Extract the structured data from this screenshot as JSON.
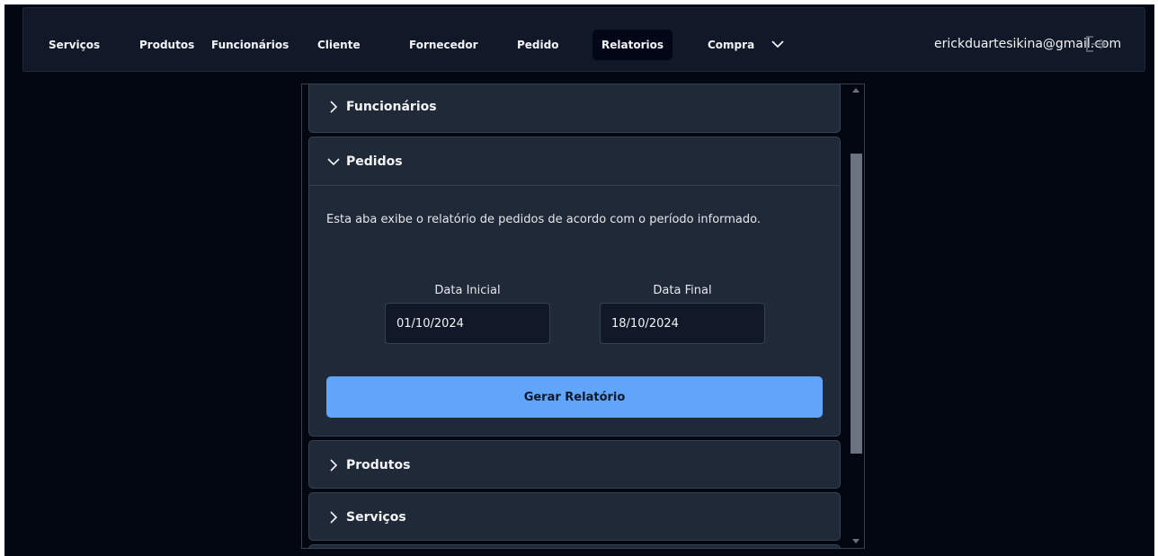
{
  "nav": {
    "items": [
      {
        "label": "Serviços"
      },
      {
        "label": "Produtos"
      },
      {
        "label": "Funcionários"
      },
      {
        "label": "Cliente"
      },
      {
        "label": "Fornecedor"
      },
      {
        "label": "Pedido"
      },
      {
        "label": "Relatorios"
      }
    ],
    "active_item": "Relatorios",
    "dropdown_label": "Compra",
    "dropdown_icon": "chevron-down-icon",
    "user_email": "erickduartesikina@gmail.com",
    "logout_icon": "logout-icon"
  },
  "accordion": {
    "sections": [
      {
        "title": "Funcionários",
        "expanded": false
      },
      {
        "title": "Pedidos",
        "expanded": true
      },
      {
        "title": "Produtos",
        "expanded": false
      },
      {
        "title": "Serviços",
        "expanded": false
      }
    ],
    "pedidos": {
      "description": "Esta aba exibe o relatório de pedidos de acordo com o período informado.",
      "start_label": "Data Inicial",
      "start_value": "01/10/2024",
      "end_label": "Data Final",
      "end_value": "18/10/2024",
      "button_label": "Gerar Relatório"
    }
  },
  "colors": {
    "background": "#030712",
    "navbar": "#111827",
    "panel": "#1f2937",
    "accent_button": "#60a5fa",
    "text": "#f3f4f6"
  }
}
